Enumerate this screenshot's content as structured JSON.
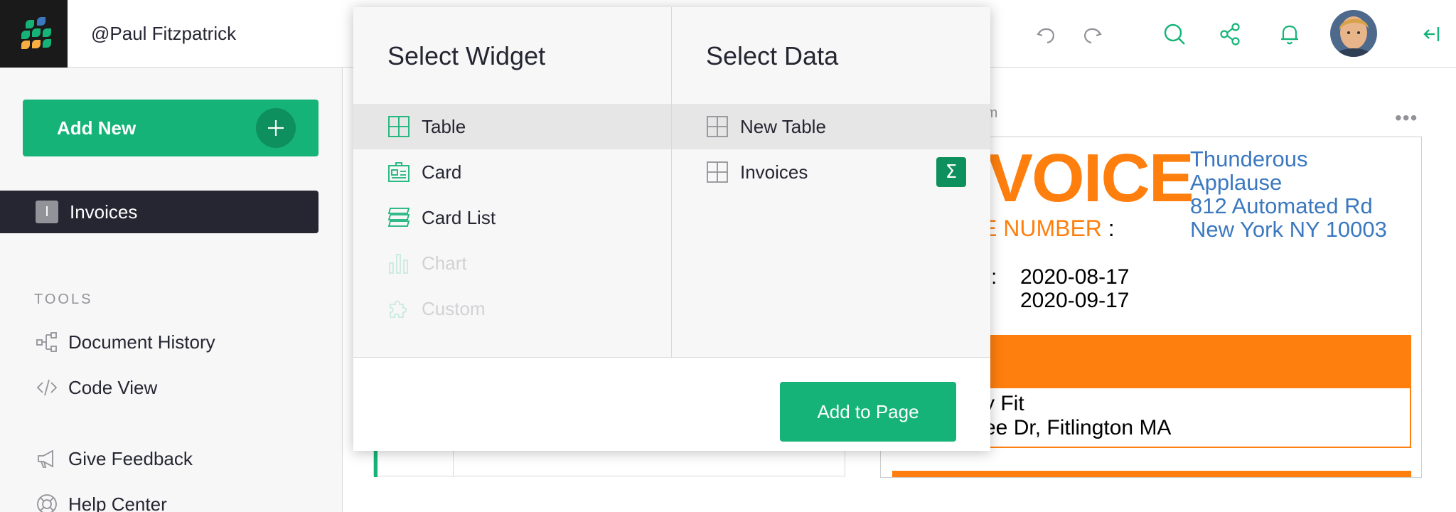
{
  "header": {
    "user_name": "@Paul Fitzpatrick",
    "icons": [
      "undo-icon",
      "redo-icon",
      "search-icon",
      "share-icon",
      "bell-icon",
      "avatar",
      "collapse-panel-icon"
    ]
  },
  "sidebar": {
    "add_new_label": "Add New",
    "pages": [
      {
        "initial": "I",
        "label": "Invoices"
      }
    ],
    "tools_label": "TOOLS",
    "tools": [
      {
        "label": "Document History",
        "icon": "history-icon"
      },
      {
        "label": "Code View",
        "icon": "code-icon"
      }
    ],
    "extras": [
      {
        "label": "Give Feedback",
        "icon": "megaphone-icon"
      },
      {
        "label": "Help Center",
        "icon": "lifebuoy-icon"
      }
    ]
  },
  "background": {
    "section_label": "tom",
    "more_label": "•••",
    "invoice": {
      "title": "VOICE",
      "number_label": "E NUMBER",
      "number_colon": ":",
      "company_lines": [
        "Thunderous",
        "Applause",
        "812 Automated Rd",
        "New York NY 10003"
      ],
      "date_colon": ":",
      "dates": [
        "2020-08-17",
        "2020-09-17"
      ],
      "billto_lines": [
        "y Fit",
        "ee Dr, Fitlington MA"
      ]
    }
  },
  "modal": {
    "widget_heading": "Select Widget",
    "data_heading": "Select Data",
    "widgets": [
      {
        "label": "Table",
        "icon": "table-icon",
        "selected": true,
        "disabled": false
      },
      {
        "label": "Card",
        "icon": "card-icon",
        "selected": false,
        "disabled": false
      },
      {
        "label": "Card List",
        "icon": "card-list-icon",
        "selected": false,
        "disabled": false
      },
      {
        "label": "Chart",
        "icon": "chart-icon",
        "selected": false,
        "disabled": true
      },
      {
        "label": "Custom",
        "icon": "custom-widget-icon",
        "selected": false,
        "disabled": true
      }
    ],
    "data_sources": [
      {
        "label": "New Table",
        "icon": "table-icon",
        "selected": true
      },
      {
        "label": "Invoices",
        "icon": "table-icon",
        "selected": false,
        "summary_symbol": "Σ"
      }
    ],
    "add_button_label": "Add to Page"
  },
  "colors": {
    "brand_green": "#16b378",
    "dark_green": "#0e8f5e",
    "invoice_orange": "#ff7f0e",
    "invoice_blue": "#3b78bf",
    "dark_nav": "#262633"
  }
}
